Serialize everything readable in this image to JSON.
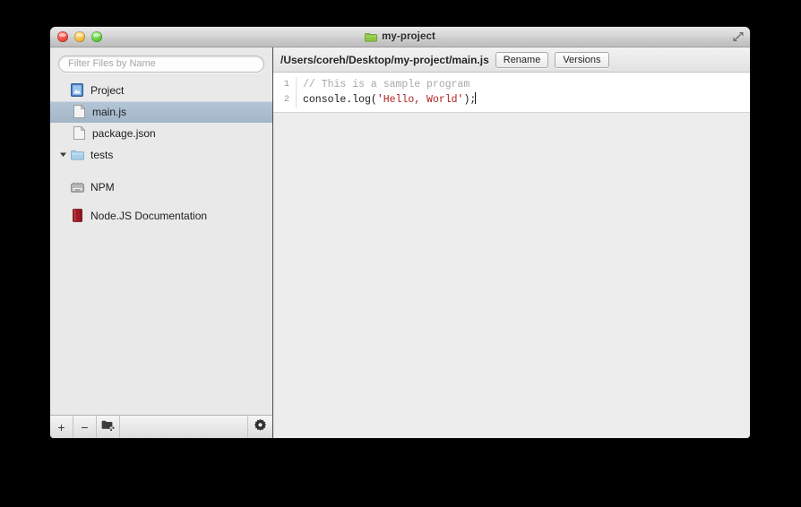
{
  "window": {
    "title": "my-project",
    "title_icon": "green-folder-icon",
    "fullscreen_icon": "fullscreen-expand-icon",
    "traffic_lights": [
      {
        "name": "close",
        "color": "#e8453c"
      },
      {
        "name": "minimize",
        "color": "#efb73c"
      },
      {
        "name": "zoom",
        "color": "#5cc83a"
      }
    ]
  },
  "sidebar": {
    "filter": {
      "value": "",
      "placeholder": "Filter Files by Name"
    },
    "tree": [
      {
        "label": "Project",
        "icon": "project-blueprint-icon",
        "indent": 0,
        "selected": false,
        "disclosure": "none"
      },
      {
        "label": "main.js",
        "icon": "file-icon",
        "indent": 1,
        "selected": true,
        "disclosure": "none"
      },
      {
        "label": "package.json",
        "icon": "file-icon",
        "indent": 1,
        "selected": false,
        "disclosure": "none"
      },
      {
        "label": "tests",
        "icon": "blue-folder-icon",
        "indent": 0,
        "selected": false,
        "disclosure": "expanded"
      },
      {
        "label": "NPM",
        "icon": "npm-box-icon",
        "indent": 0,
        "selected": false,
        "disclosure": "none"
      },
      {
        "label": "Node.JS Documentation",
        "icon": "red-book-icon",
        "indent": 0,
        "selected": false,
        "disclosure": "none"
      }
    ],
    "toolbar": {
      "add_label": "+",
      "remove_label": "−",
      "new_folder_icon": "new-folder-icon",
      "action_icon": "gear-action-icon"
    }
  },
  "editor": {
    "path": "/Users/coreh/Desktop/my-project/main.js",
    "rename_label": "Rename",
    "versions_label": "Versions",
    "lines": [
      {
        "number": "1",
        "tokens": [
          {
            "text": "// This is a sample program",
            "type": "comment"
          }
        ]
      },
      {
        "number": "2",
        "tokens": [
          {
            "text": "console.log(",
            "type": "plain"
          },
          {
            "text": "'Hello, World'",
            "type": "string"
          },
          {
            "text": ");",
            "type": "plain"
          }
        ],
        "caret": true
      }
    ]
  },
  "colors": {
    "selection": "#a8bdd0",
    "string": "#b02020",
    "comment": "#a8a8a8",
    "title_folder": "#7ac142",
    "red_book": "#951420"
  }
}
